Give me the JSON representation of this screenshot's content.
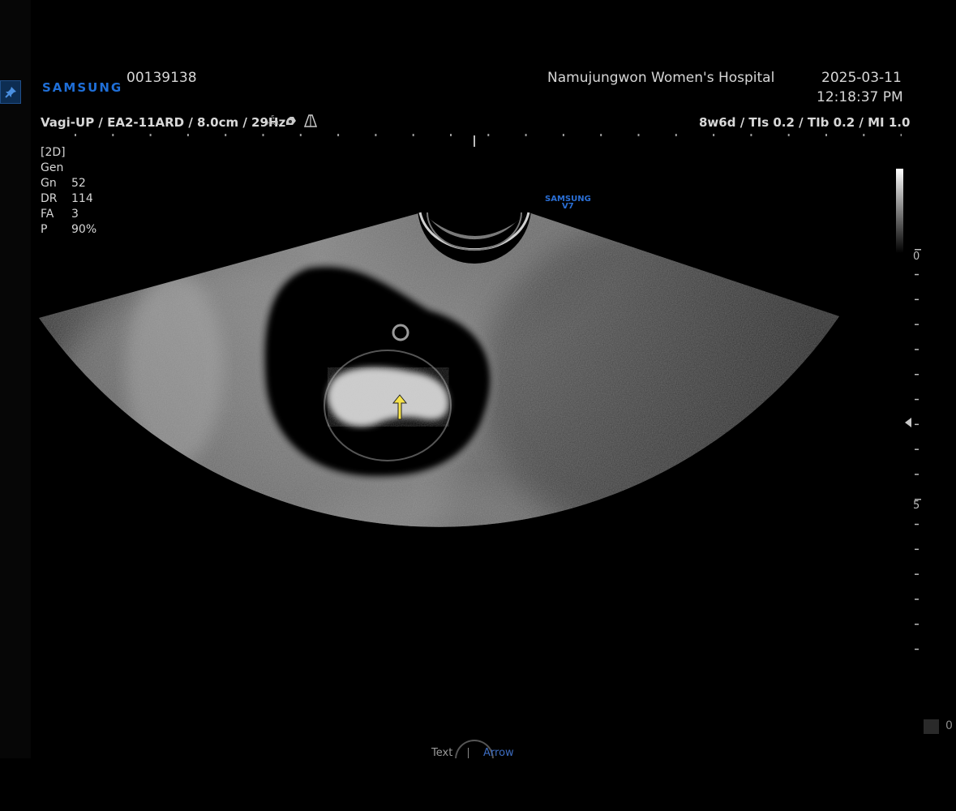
{
  "header": {
    "brand": "SAMSUNG",
    "patient_id": "00139138",
    "hospital": "Namujungwon Women's  Hospital",
    "date": "2025-03-11",
    "time": "12:18:37 PM"
  },
  "probe_line": {
    "text": "Vagi-UP / EA2-11ARD / 8.0cm / 29Hz",
    "harmonic_top": "S",
    "harmonic_bottom": "HAR",
    "indices": "8w6d / TIs  0.2 / TIb  0.2 / MI   1.0"
  },
  "params": {
    "mode": "[2D]",
    "preset": "Gen",
    "rows": [
      {
        "k": "Gn",
        "v": "52"
      },
      {
        "k": "DR",
        "v": "114"
      },
      {
        "k": "FA",
        "v": "3"
      },
      {
        "k": "P",
        "v": "90%"
      }
    ]
  },
  "image_watermark": {
    "line1": "SAMSUNG",
    "line2": "V7"
  },
  "depth_scale": {
    "label_top": "0",
    "label_mid": "5"
  },
  "bottom": {
    "box_value": "0",
    "text_label": "Text",
    "arrow_label": "Arrow"
  },
  "colors": {
    "brand": "#1f6fd8",
    "annotation_arrow": "#f5e24a",
    "background": "#000000"
  },
  "icons": [
    "pin-icon",
    "harmonic-icon",
    "probe-icon",
    "beam-icon",
    "arrow-annotation-icon",
    "focus-marker-icon"
  ]
}
